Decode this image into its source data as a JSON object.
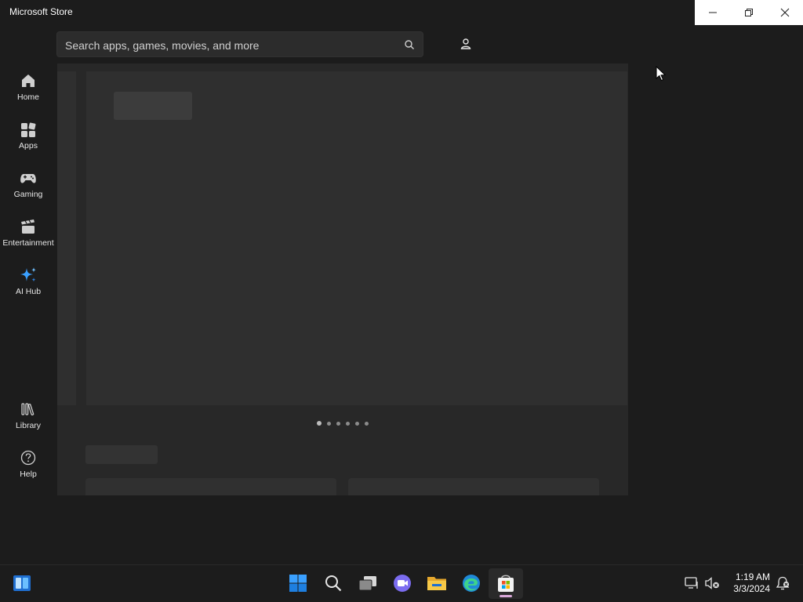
{
  "window": {
    "title": "Microsoft Store",
    "caption_buttons": [
      "minimize-icon",
      "restore-icon",
      "close-icon"
    ]
  },
  "search": {
    "placeholder": "Search apps, games, movies, and more"
  },
  "sidebar": {
    "items": [
      {
        "label": "Home",
        "icon": "home-icon"
      },
      {
        "label": "Apps",
        "icon": "apps-icon"
      },
      {
        "label": "Gaming",
        "icon": "gamepad-icon"
      },
      {
        "label": "Entertainment",
        "icon": "clapperboard-icon"
      },
      {
        "label": "AI Hub",
        "icon": "sparkle-icon"
      }
    ],
    "bottom_items": [
      {
        "label": "Library",
        "icon": "library-icon"
      },
      {
        "label": "Help",
        "icon": "help-icon"
      }
    ]
  },
  "carousel": {
    "page_count": 6,
    "active_index": 0
  },
  "taskbar": {
    "apps": [
      "widgets-icon",
      "start-icon",
      "search-icon",
      "task-view-icon",
      "chat-icon",
      "file-explorer-icon",
      "edge-icon",
      "store-icon"
    ],
    "active_app": "store-icon",
    "tray": [
      "display-icon",
      "volume-muted-icon",
      "notification-icon"
    ],
    "time": "1:19 AM",
    "date": "3/3/2024"
  },
  "colors": {
    "background": "#1c1c1c",
    "accent_blue": "#3aa0ff"
  }
}
